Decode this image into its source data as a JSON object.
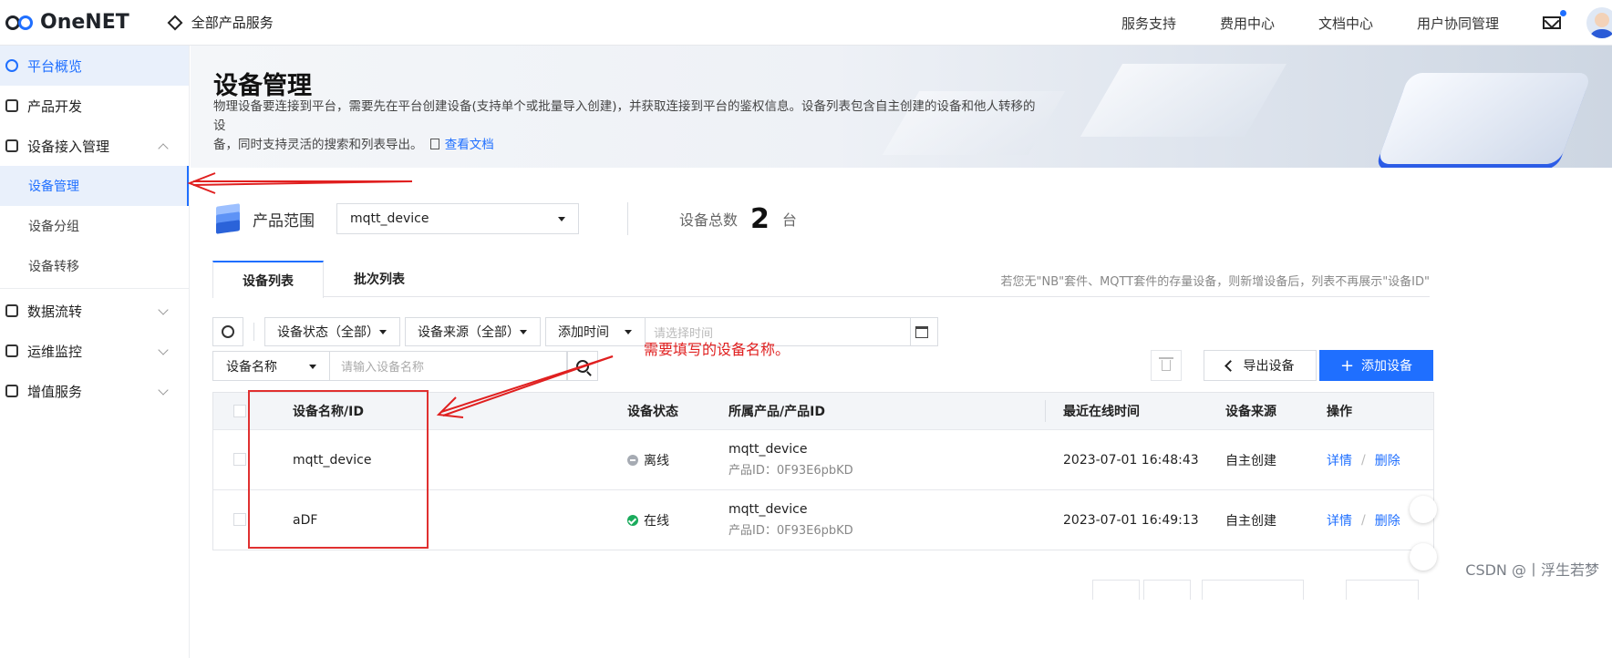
{
  "header": {
    "logo": "OneNET",
    "all_products": "全部产品服务",
    "nav": [
      "服务支持",
      "费用中心",
      "文档中心",
      "用户协同管理"
    ]
  },
  "sidebar": {
    "items": [
      {
        "label": "平台概览",
        "icon": "overview-icon",
        "active": true
      },
      {
        "label": "产品开发",
        "icon": "cube-icon"
      },
      {
        "label": "设备接入管理",
        "icon": "device-icon",
        "expanded": true,
        "children": [
          {
            "label": "设备管理",
            "active": true
          },
          {
            "label": "设备分组"
          },
          {
            "label": "设备转移"
          }
        ]
      },
      {
        "label": "数据流转",
        "icon": "dataflow-icon"
      },
      {
        "label": "运维监控",
        "icon": "monitor-icon"
      },
      {
        "label": "增值服务",
        "icon": "plane-icon"
      }
    ]
  },
  "banner": {
    "title": "设备管理",
    "desc_line1": "物理设备要连接到平台，需要先在平台创建设备(支持单个或批量导入创建)，并获取连接到平台的鉴权信息。设备列表包含自主创建的设备和他人转移的设",
    "desc_line2": "备，同时支持灵活的搜索和列表导出。",
    "doc_link": "查看文档"
  },
  "product_scope": {
    "label": "产品范围",
    "selected": "mqtt_device",
    "total_label": "设备总数",
    "total": "2",
    "unit": "台"
  },
  "tabs": {
    "items": [
      "设备列表",
      "批次列表"
    ],
    "note": "若您无\"NB\"套件、MQTT套件的存量设备，则新增设备后，列表不再展示\"设备ID\""
  },
  "filters": {
    "status": "设备状态（全部）",
    "source": "设备来源（全部）",
    "time": "添加时间",
    "time_placeholder": "请选择时间",
    "name_field": "设备名称",
    "name_placeholder": "请输入设备名称"
  },
  "actions": {
    "export": "导出设备",
    "add": "添加设备"
  },
  "table": {
    "columns": [
      "设备名称/ID",
      "设备状态",
      "所属产品/产品ID",
      "最近在线时间",
      "设备来源",
      "操作"
    ],
    "rows": [
      {
        "name": "mqtt_device",
        "status": "离线",
        "product": "mqtt_device",
        "product_id": "产品ID：0F93E6pbKD",
        "last_online": "2023-07-01 16:48:43",
        "source": "自主创建",
        "detail": "详情",
        "delete": "删除"
      },
      {
        "name": "aDF",
        "status": "在线",
        "product": "mqtt_device",
        "product_id": "产品ID：0F93E6pbKD",
        "last_online": "2023-07-01 16:49:13",
        "source": "自主创建",
        "detail": "详情",
        "delete": "删除"
      }
    ],
    "op_sep": "/"
  },
  "annotation": {
    "text": "需要填写的设备名称。",
    "color": "#e02020"
  },
  "watermark": "CSDN @丨浮生若梦",
  "colors": {
    "accent": "#1f6fff",
    "online": "#1aab5c",
    "offline": "#a6abb3"
  }
}
